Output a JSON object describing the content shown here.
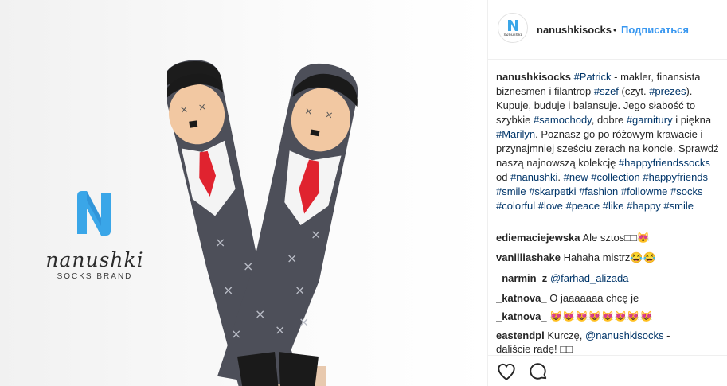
{
  "media": {
    "brand_name": "nanushki",
    "brand_sub": "SOCKS BRAND",
    "colors": {
      "brand_blue": "#3aa6e8",
      "sock_gray": "#4d4f59",
      "tie_red": "#e0232f",
      "skin": "#f2c8a2"
    }
  },
  "header": {
    "avatar_text": "nanushki",
    "username": "nanushkisocks",
    "separator": "•",
    "follow_label": "Подписаться"
  },
  "caption": {
    "username": "nanushkisocks",
    "parts": [
      {
        "t": "tag",
        "v": "#Patrick"
      },
      {
        "t": "text",
        "v": " - makler, finansista biznesmen i filantrop "
      },
      {
        "t": "tag",
        "v": "#szef"
      },
      {
        "t": "text",
        "v": " (czyt. "
      },
      {
        "t": "tag",
        "v": "#prezes"
      },
      {
        "t": "text",
        "v": "). Kupuje, buduje i balansuje. Jego słabość to szybkie "
      },
      {
        "t": "tag",
        "v": "#samochody"
      },
      {
        "t": "text",
        "v": ", dobre "
      },
      {
        "t": "tag",
        "v": "#garnitury"
      },
      {
        "t": "text",
        "v": " i piękna "
      },
      {
        "t": "tag",
        "v": "#Marilyn"
      },
      {
        "t": "text",
        "v": ". Poznasz go po różowym krawacie i przynajmniej sześciu zerach na koncie. Sprawdź naszą najnowszą kolekcję "
      },
      {
        "t": "tag",
        "v": "#happyfriendssocks"
      },
      {
        "t": "text",
        "v": " od "
      },
      {
        "t": "tag",
        "v": "#nanushki"
      },
      {
        "t": "text",
        "v": ". "
      },
      {
        "t": "tag",
        "v": "#new"
      },
      {
        "t": "text",
        "v": " "
      },
      {
        "t": "tag",
        "v": "#collection"
      },
      {
        "t": "text",
        "v": " "
      },
      {
        "t": "tag",
        "v": "#happyfriends"
      },
      {
        "t": "text",
        "v": " "
      },
      {
        "t": "tag",
        "v": "#smile"
      },
      {
        "t": "text",
        "v": " "
      },
      {
        "t": "tag",
        "v": "#skarpetki"
      },
      {
        "t": "text",
        "v": " "
      },
      {
        "t": "tag",
        "v": "#fashion"
      },
      {
        "t": "text",
        "v": " "
      },
      {
        "t": "tag",
        "v": "#followme"
      },
      {
        "t": "text",
        "v": " "
      },
      {
        "t": "tag",
        "v": "#socks"
      },
      {
        "t": "text",
        "v": " "
      },
      {
        "t": "tag",
        "v": "#colorful"
      },
      {
        "t": "text",
        "v": " "
      },
      {
        "t": "tag",
        "v": "#love"
      },
      {
        "t": "text",
        "v": " "
      },
      {
        "t": "tag",
        "v": "#peace"
      },
      {
        "t": "text",
        "v": " "
      },
      {
        "t": "tag",
        "v": "#like"
      },
      {
        "t": "text",
        "v": " "
      },
      {
        "t": "tag",
        "v": "#happy"
      },
      {
        "t": "text",
        "v": " "
      },
      {
        "t": "tag",
        "v": "#smile"
      }
    ]
  },
  "comments": [
    {
      "user": "ediemaciejewska",
      "text": "Ale sztos□□😻"
    },
    {
      "user": "vanilliashake",
      "text": "Hahaha mistrz😂😂"
    },
    {
      "user": "_narmin_z",
      "mention": "@farhad_alizada",
      "text": ""
    },
    {
      "user": "_katnova_",
      "text": "O jaaaaaaa chcę je"
    },
    {
      "user": "_katnova_",
      "text": "😻😻😻😻😻😻😻😻"
    },
    {
      "user": "eastendpl",
      "text": "Kurczę, ",
      "mention": "@nanushkisocks",
      "text2": " -"
    },
    {
      "user": "",
      "text": "daliście radę! □□"
    }
  ],
  "actions": {
    "like_label": "like",
    "comment_label": "comment"
  }
}
